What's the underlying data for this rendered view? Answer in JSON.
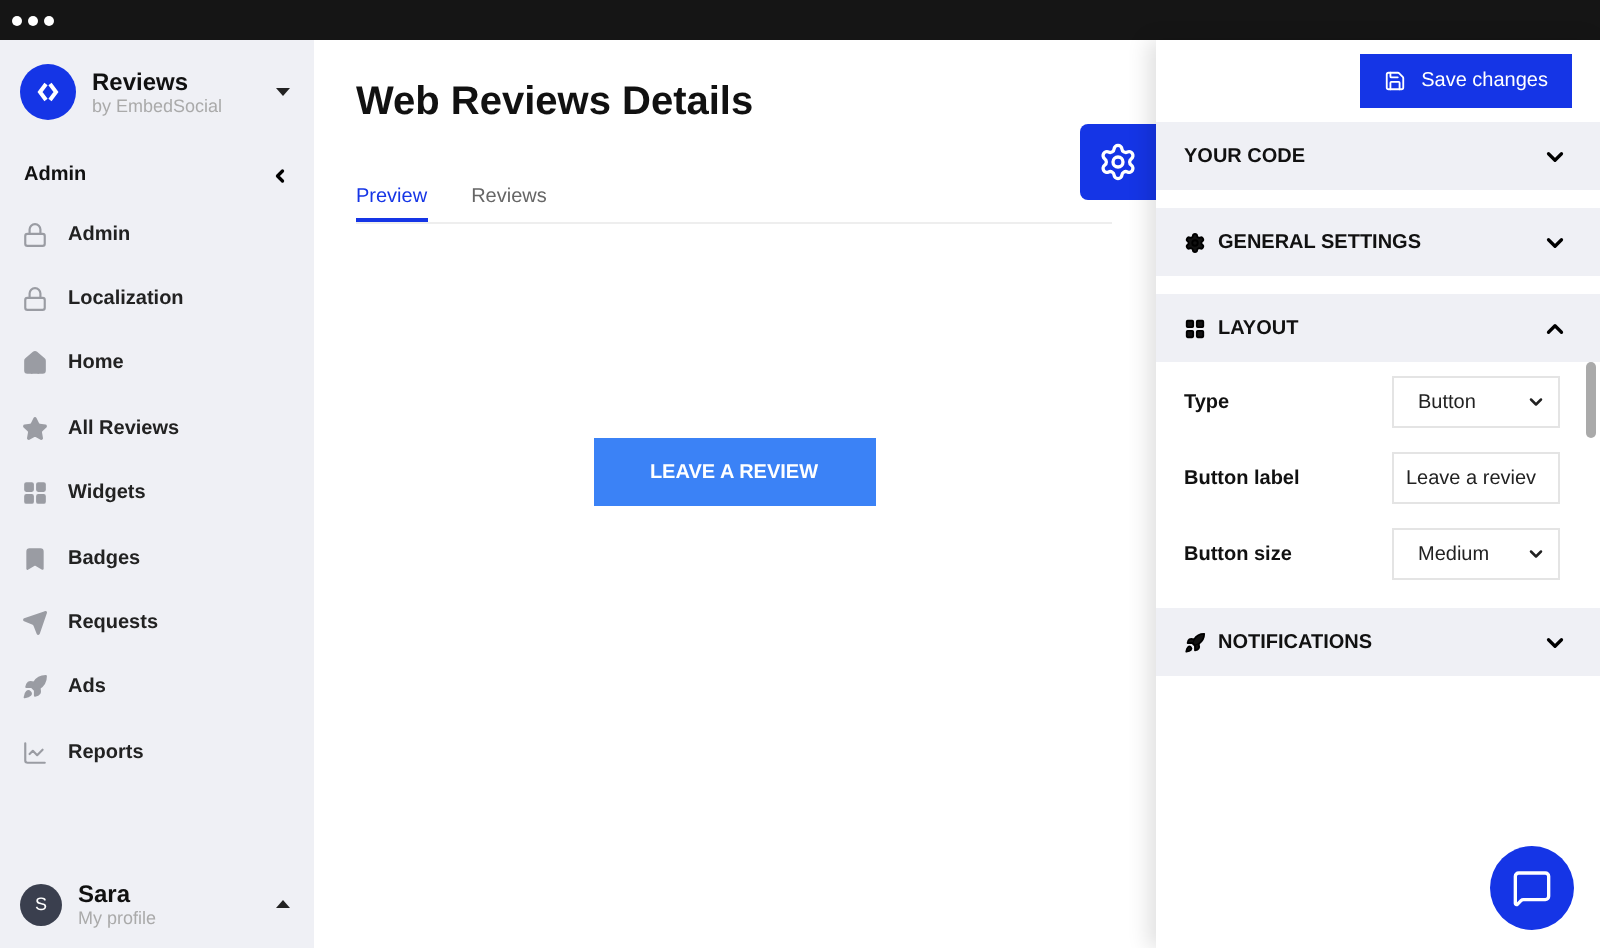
{
  "brand": {
    "name": "Reviews",
    "subtitle": "by EmbedSocial"
  },
  "sidebar": {
    "group": "Admin",
    "items": [
      {
        "label": "Admin",
        "selected": false
      },
      {
        "label": "Localization",
        "selected": false
      },
      {
        "label": "Home",
        "selected": false
      },
      {
        "label": "All Reviews",
        "selected": false
      },
      {
        "label": "Widgets",
        "selected": false
      },
      {
        "label": "Badges",
        "selected": false
      },
      {
        "label": "Requests",
        "selected": false
      },
      {
        "label": "Ads",
        "selected": false
      },
      {
        "label": "Reports",
        "selected": false
      }
    ]
  },
  "user": {
    "initial": "S",
    "name": "Sara",
    "subtitle": "My profile"
  },
  "page": {
    "title": "Web Reviews Details",
    "tabs": [
      {
        "label": "Preview",
        "selected": true
      },
      {
        "label": "Reviews",
        "selected": false
      }
    ],
    "preview_button": "LEAVE A REVIEW"
  },
  "panel": {
    "save_button": "Save changes",
    "sections": [
      {
        "title": "YOUR CODE",
        "expanded": false
      },
      {
        "title": "GENERAL SETTINGS",
        "expanded": false
      },
      {
        "title": "LAYOUT",
        "expanded": true,
        "fields": [
          {
            "label": "Type",
            "kind": "select",
            "value": "Button"
          },
          {
            "label": "Button label",
            "kind": "text",
            "value": "Leave a reviev"
          },
          {
            "label": "Button size",
            "kind": "select",
            "value": "Medium"
          }
        ]
      },
      {
        "title": "NOTIFICATIONS",
        "expanded": false
      }
    ]
  }
}
